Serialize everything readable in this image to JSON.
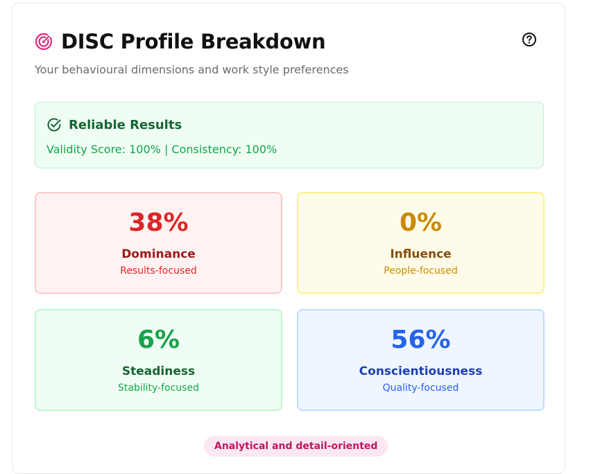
{
  "header": {
    "title": "DISC Profile Breakdown",
    "subtitle": "Your behavioural dimensions and work style preferences",
    "title_icon": "target-icon",
    "help_icon": "help-circle-icon"
  },
  "reliability": {
    "icon": "check-circle-icon",
    "title": "Reliable Results",
    "detail": "Validity Score: 100% | Consistency: 100%"
  },
  "metrics": [
    {
      "key": "D",
      "value": "38%",
      "label": "Dominance",
      "description": "Results-focused",
      "color": "#dc2626"
    },
    {
      "key": "I",
      "value": "0%",
      "label": "Influence",
      "description": "People-focused",
      "color": "#ca8a04"
    },
    {
      "key": "S",
      "value": "6%",
      "label": "Steadiness",
      "description": "Stability-focused",
      "color": "#16a34a"
    },
    {
      "key": "C",
      "value": "56%",
      "label": "Conscientiousness",
      "description": "Quality-focused",
      "color": "#2563eb"
    }
  ],
  "trait_badge": "Analytical and detail-oriented",
  "colors": {
    "accent_pink": "#db2777",
    "success_green": "#16a34a"
  }
}
